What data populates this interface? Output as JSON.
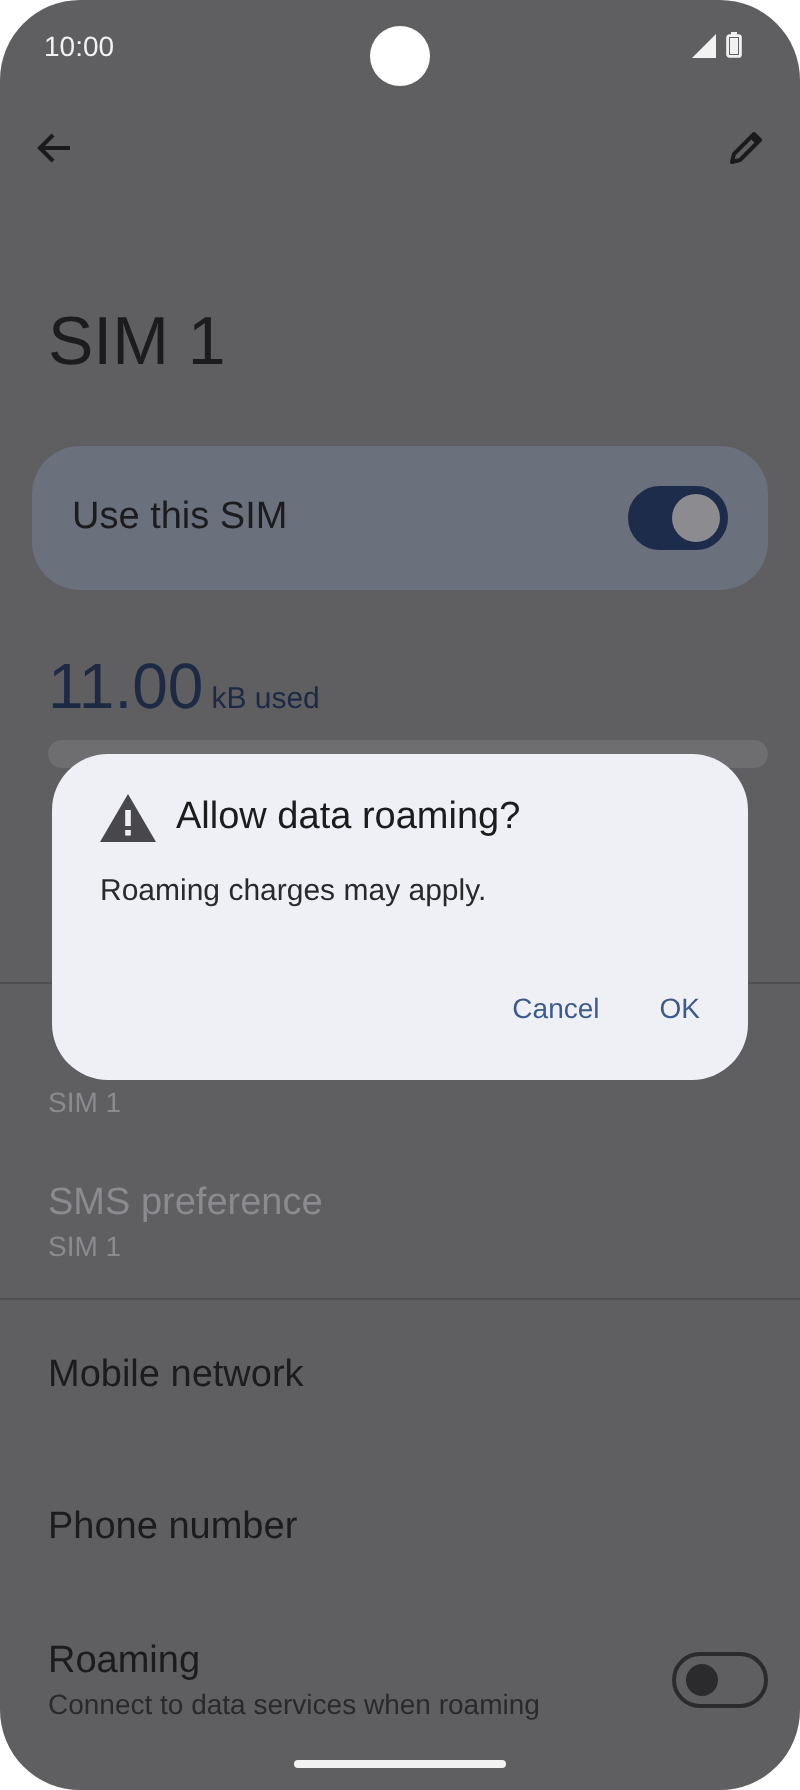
{
  "status_bar": {
    "time": "10:00"
  },
  "title": "SIM 1",
  "use_sim": {
    "label": "Use this SIM",
    "on": true
  },
  "usage": {
    "amount": "11.00",
    "unit": "kB used"
  },
  "sections": [
    {
      "rows": [
        {
          "subtitle": "SIM 1",
          "disabled": true
        },
        {
          "title": "SMS preference",
          "subtitle": "SIM 1",
          "disabled": true
        }
      ]
    },
    {
      "rows": [
        {
          "title": "Mobile network",
          "disabled": false
        },
        {
          "title": "Phone number",
          "disabled": false
        },
        {
          "title": "Roaming",
          "subtitle": "Connect to data services when roaming",
          "disabled": false,
          "toggle": {
            "on": false
          }
        }
      ]
    }
  ],
  "dialog": {
    "title": "Allow data roaming?",
    "message": "Roaming charges may apply.",
    "buttons": [
      "Cancel",
      "OK"
    ]
  }
}
